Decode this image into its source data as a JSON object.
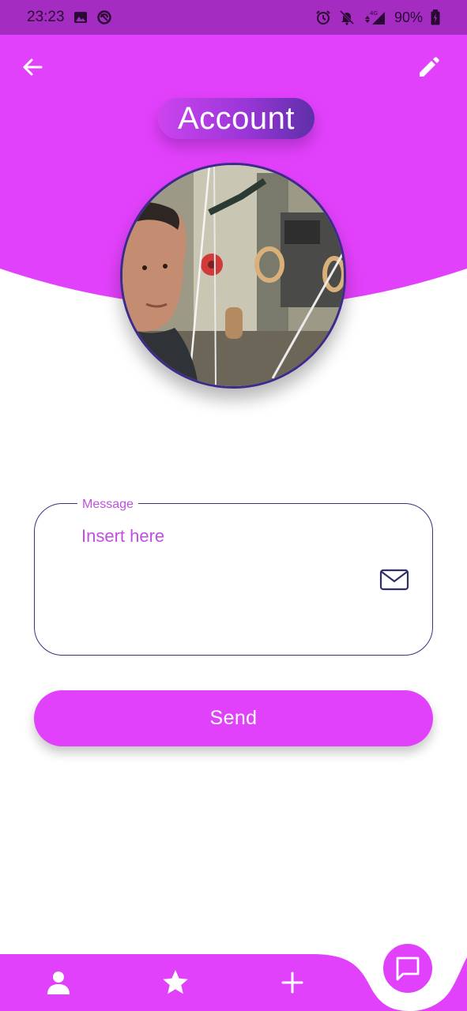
{
  "status_bar": {
    "time": "23:23",
    "battery": "90%",
    "network": "4G",
    "icons": [
      "image-icon",
      "sync-icon",
      "alarm-icon",
      "notifications-off-icon",
      "signal-icon",
      "battery-icon"
    ]
  },
  "header": {
    "title": "Account",
    "back_icon": "arrow-left-icon",
    "edit_icon": "pencil-icon"
  },
  "profile": {
    "avatar": "profile-photo"
  },
  "message_form": {
    "label": "Message",
    "placeholder": "Insert here",
    "value": "",
    "icon": "mail-icon",
    "send_label": "Send"
  },
  "bottom_nav": {
    "items": [
      {
        "icon": "person-icon"
      },
      {
        "icon": "star-icon"
      },
      {
        "icon": "plus-icon"
      }
    ],
    "fab_icon": "chat-icon"
  },
  "colors": {
    "primary": "#e241fb",
    "status_bar": "#a42cc0",
    "accent_dark": "#3c2f7e",
    "title_gradient_start": "#cc44ee",
    "title_gradient_end": "#5e2fa8",
    "text_on_primary": "#ffffff"
  }
}
